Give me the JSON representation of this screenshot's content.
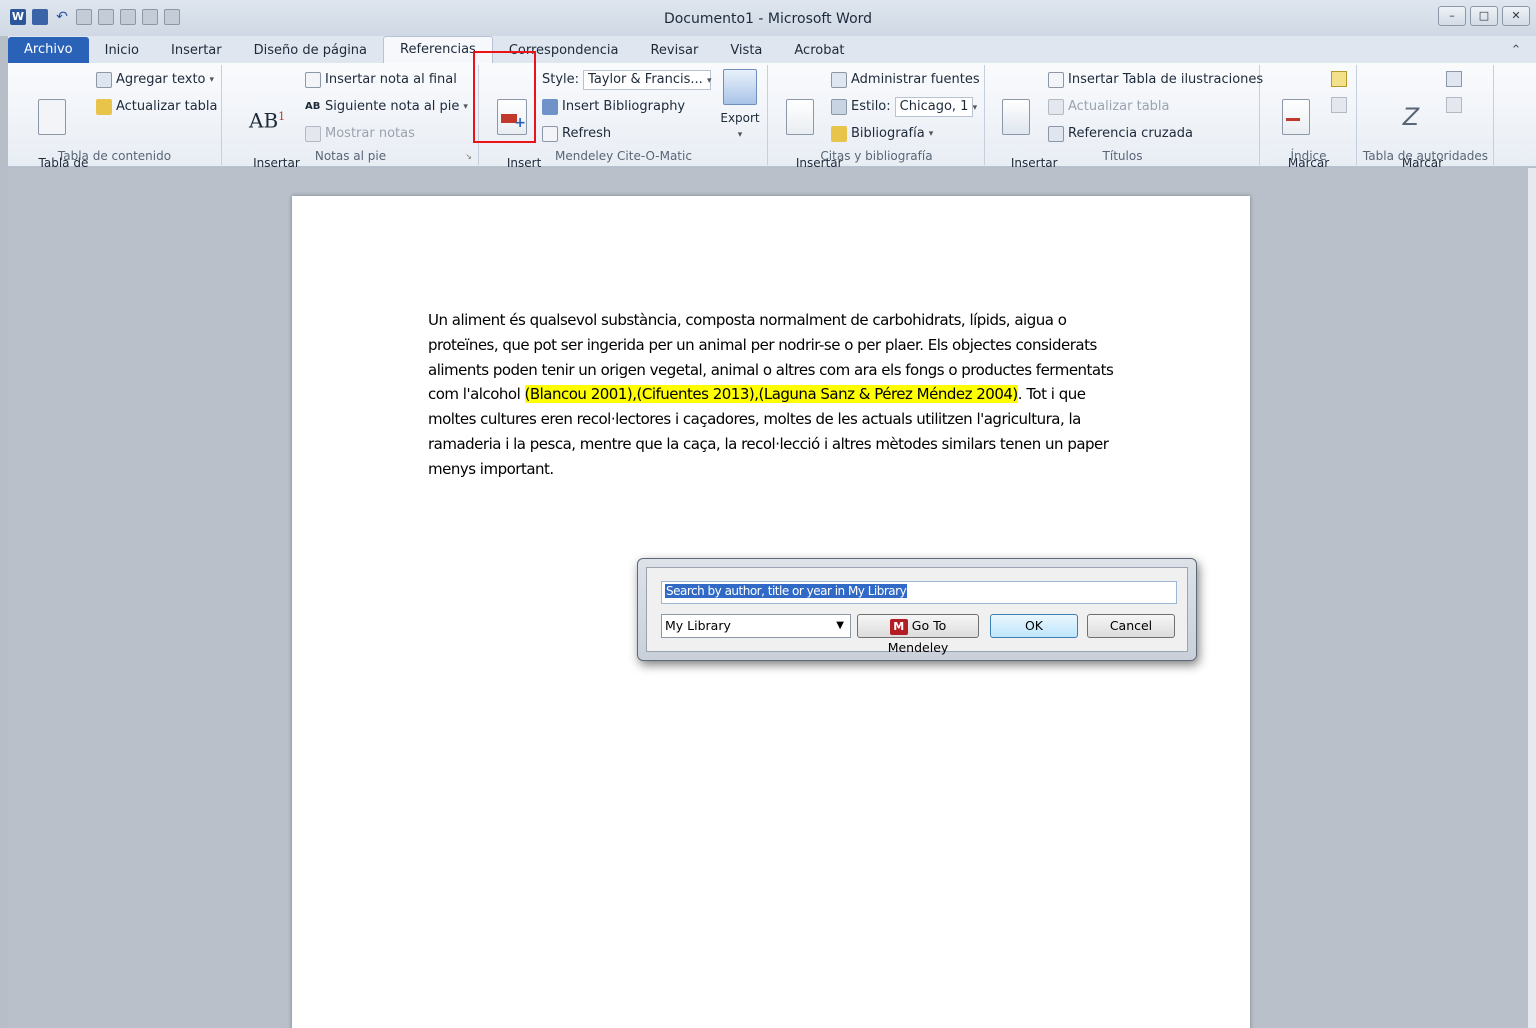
{
  "window": {
    "title": "Documento1  -  Microsoft Word",
    "word_logo": "W",
    "controls": {
      "minimize": "–",
      "maximize": "□",
      "close": "✕"
    }
  },
  "tabs": [
    {
      "label": "Archivo"
    },
    {
      "label": "Inicio"
    },
    {
      "label": "Insertar"
    },
    {
      "label": "Diseño de página"
    },
    {
      "label": "Referencias"
    },
    {
      "label": "Correspondencia"
    },
    {
      "label": "Revisar"
    },
    {
      "label": "Vista"
    },
    {
      "label": "Acrobat"
    }
  ],
  "ribbon_collapse": "⌃",
  "ribbon": {
    "toc": {
      "label": "Tabla de contenido",
      "toc_button": "Tabla de\ncontenido ▾",
      "add_text": "Agregar texto",
      "update_table": "Actualizar tabla"
    },
    "footnotes": {
      "label": "Notas al pie",
      "insert_footnote": "Insertar\nnota al pie",
      "insert_endnote": "Insertar nota al final",
      "next_footnote": "Siguiente nota al pie",
      "show_notes": "Mostrar notas",
      "ab_glyph": "AB"
    },
    "mendeley": {
      "label": "Mendeley Cite-O-Matic",
      "insert_citation": "Insert\nCitation",
      "style_label": "Style:",
      "style_value": "Taylor & Francis...",
      "insert_bibliography": "Insert Bibliography",
      "refresh": "Refresh",
      "export": "Export"
    },
    "citations": {
      "label": "Citas y bibliografía",
      "insert_citation": "Insertar\ncita ▾",
      "manage_sources": "Administrar fuentes",
      "style_label": "Estilo:",
      "style_value": "Chicago, 1",
      "bibliography": "Bibliografía"
    },
    "captions": {
      "label": "Títulos",
      "insert_caption": "Insertar\ntítulo",
      "insert_table_figures": "Insertar Tabla de ilustraciones",
      "update_table": "Actualizar tabla",
      "cross_reference": "Referencia cruzada"
    },
    "index": {
      "label": "Índice",
      "mark_entry": "Marcar\nentrada"
    },
    "authorities": {
      "label": "Tabla de autoridades",
      "mark_citation": "Marcar\ncita"
    }
  },
  "document": {
    "text_before": "Un aliment és qualsevol substància, composta normalment de carbohidrats, lípids, aigua o proteïnes, que pot ser ingerida per un animal per nodrir-se o per plaer. Els objectes considerats aliments poden tenir un origen vegetal, animal o altres com ara els fongs o productes fermentats com l'alcohol ",
    "citation": "(Blancou 2001),(Cifuentes 2013),(Laguna Sanz & Pérez Méndez 2004)",
    "text_after": ". Tot i que moltes cultures eren recol·lectores i caçadores, moltes de les actuals utilitzen l'agricultura, la ramaderia i la pesca, mentre que la caça, la recol·lecció i altres mètodes similars tenen un paper menys important."
  },
  "dialog": {
    "search_placeholder": "Search by author, title or year in My Library",
    "library_selected": "My Library",
    "go_to_mendeley": "Go To Mendeley",
    "mendeley_logo": "M",
    "ok": "OK",
    "cancel": "Cancel"
  },
  "colors": {
    "highlight": "#ffff00",
    "file_tab": "#2a62b8",
    "red_box": "#e8141a"
  }
}
